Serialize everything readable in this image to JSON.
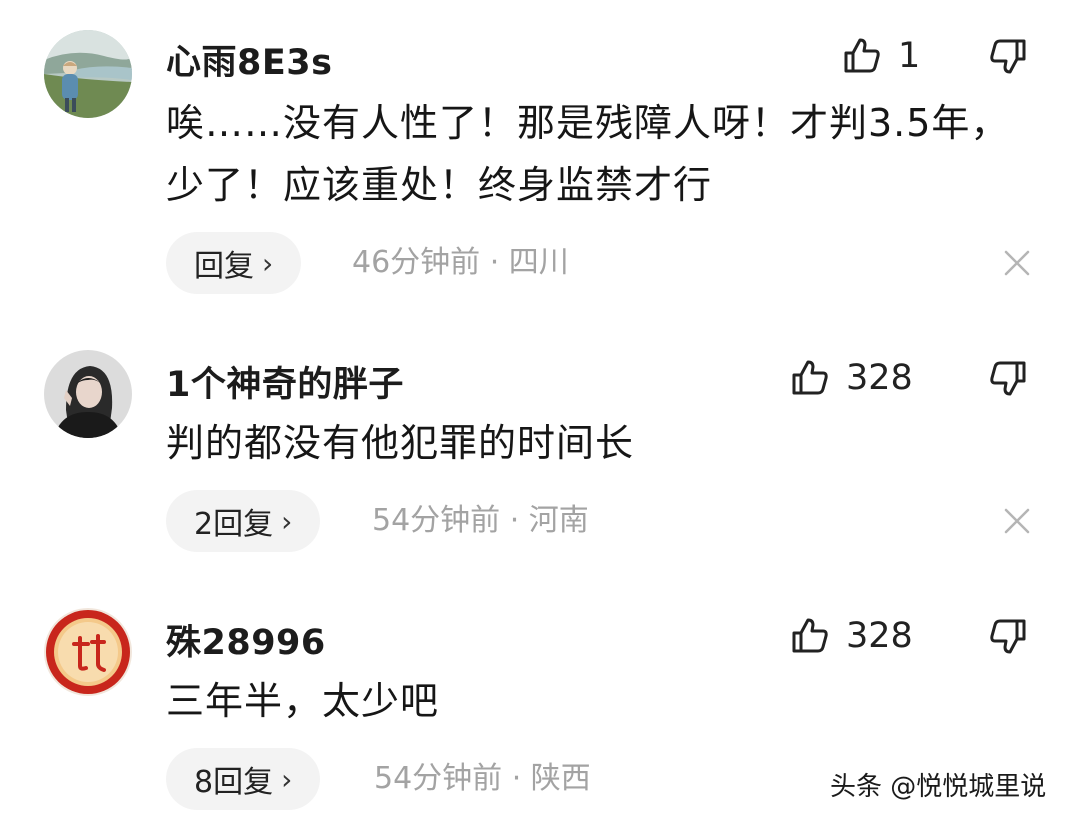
{
  "comments": [
    {
      "username": "心雨8E3s",
      "like_count": "1",
      "text": "唉……没有人性了！那是残障人呀！才判3.5年，少了！应该重处！终身监禁才行",
      "reply_label": "回复",
      "reply_chevron": "›",
      "meta": "46分钟前 · 四川",
      "avatar": "landscape-photo-avatar"
    },
    {
      "username": "1个神奇的胖子",
      "like_count": "328",
      "text": "判的都没有他犯罪的时间长",
      "reply_label": "2回复",
      "reply_chevron": "›",
      "meta": "54分钟前 · 河南",
      "avatar": "person-photo-avatar"
    },
    {
      "username": "殊28996",
      "like_count": "328",
      "text": "三年半，太少吧",
      "reply_label": "8回复",
      "reply_chevron": "›",
      "meta": "54分钟前 · 陕西",
      "avatar": "seal-logo-avatar"
    }
  ],
  "icons": {
    "like": "thumbs-up-icon",
    "dislike": "thumbs-down-icon",
    "close": "close-icon"
  },
  "watermark": "头条 @悦悦城里说",
  "colors": {
    "meta_text": "#a3a3a3",
    "pill_bg": "#f3f3f3",
    "text": "#161616"
  }
}
